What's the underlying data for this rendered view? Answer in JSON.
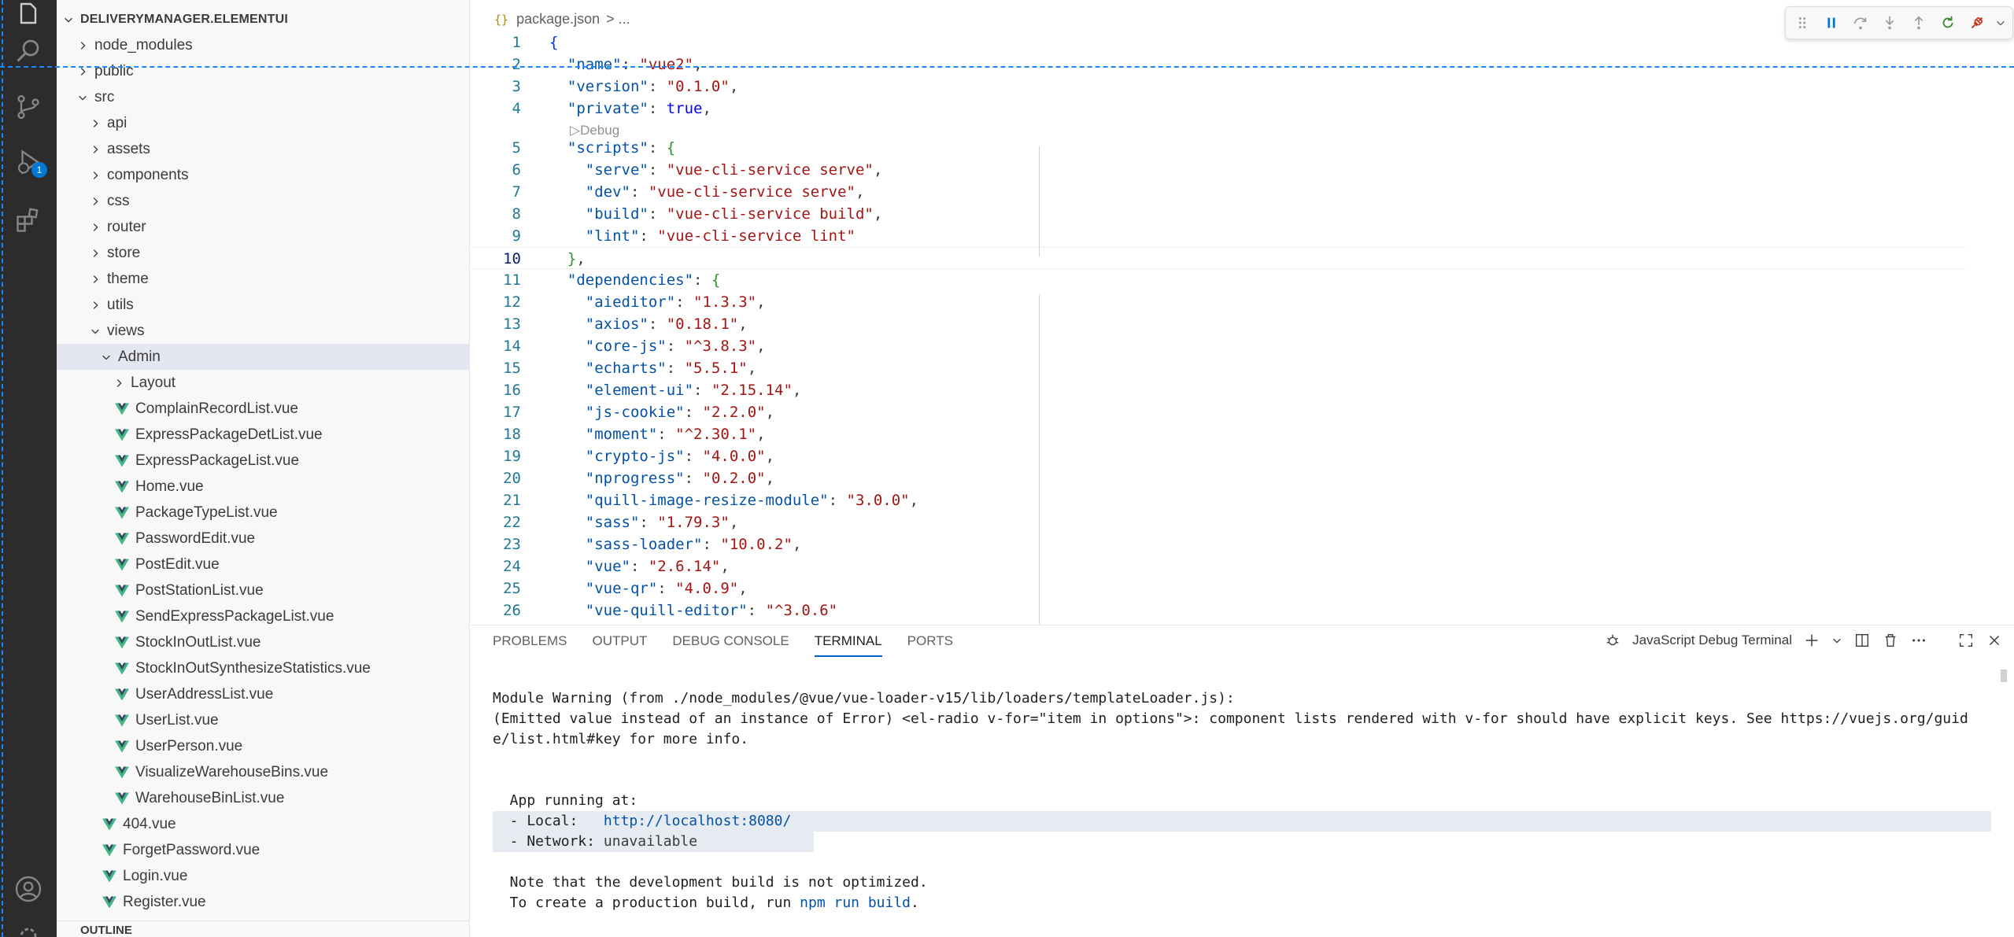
{
  "explorer": {
    "root_title": "DELIVERYMANAGER.ELEMENTUI",
    "outline_title": "OUTLINE",
    "tree": [
      {
        "label": "node_modules",
        "kind": "folder",
        "expanded": false,
        "depth": 1
      },
      {
        "label": "public",
        "kind": "folder",
        "expanded": false,
        "depth": 1
      },
      {
        "label": "src",
        "kind": "folder",
        "expanded": true,
        "depth": 1
      },
      {
        "label": "api",
        "kind": "folder",
        "expanded": false,
        "depth": 2
      },
      {
        "label": "assets",
        "kind": "folder",
        "expanded": false,
        "depth": 2
      },
      {
        "label": "components",
        "kind": "folder",
        "expanded": false,
        "depth": 2
      },
      {
        "label": "css",
        "kind": "folder",
        "expanded": false,
        "depth": 2
      },
      {
        "label": "router",
        "kind": "folder",
        "expanded": false,
        "depth": 2
      },
      {
        "label": "store",
        "kind": "folder",
        "expanded": false,
        "depth": 2
      },
      {
        "label": "theme",
        "kind": "folder",
        "expanded": false,
        "depth": 2
      },
      {
        "label": "utils",
        "kind": "folder",
        "expanded": false,
        "depth": 2
      },
      {
        "label": "views",
        "kind": "folder",
        "expanded": true,
        "depth": 2
      },
      {
        "label": "Admin",
        "kind": "folder",
        "expanded": true,
        "depth": 3,
        "selected": true
      },
      {
        "label": "Layout",
        "kind": "folder",
        "expanded": false,
        "depth": 4
      },
      {
        "label": "ComplainRecordList.vue",
        "kind": "vue",
        "depth": 4
      },
      {
        "label": "ExpressPackageDetList.vue",
        "kind": "vue",
        "depth": 4
      },
      {
        "label": "ExpressPackageList.vue",
        "kind": "vue",
        "depth": 4
      },
      {
        "label": "Home.vue",
        "kind": "vue",
        "depth": 4
      },
      {
        "label": "PackageTypeList.vue",
        "kind": "vue",
        "depth": 4
      },
      {
        "label": "PasswordEdit.vue",
        "kind": "vue",
        "depth": 4
      },
      {
        "label": "PostEdit.vue",
        "kind": "vue",
        "depth": 4
      },
      {
        "label": "PostStationList.vue",
        "kind": "vue",
        "depth": 4
      },
      {
        "label": "SendExpressPackageList.vue",
        "kind": "vue",
        "depth": 4
      },
      {
        "label": "StockInOutList.vue",
        "kind": "vue",
        "depth": 4
      },
      {
        "label": "StockInOutSynthesizeStatistics.vue",
        "kind": "vue",
        "depth": 4
      },
      {
        "label": "UserAddressList.vue",
        "kind": "vue",
        "depth": 4
      },
      {
        "label": "UserList.vue",
        "kind": "vue",
        "depth": 4
      },
      {
        "label": "UserPerson.vue",
        "kind": "vue",
        "depth": 4
      },
      {
        "label": "VisualizeWarehouseBins.vue",
        "kind": "vue",
        "depth": 4
      },
      {
        "label": "WarehouseBinList.vue",
        "kind": "vue",
        "depth": 4
      },
      {
        "label": "404.vue",
        "kind": "vue",
        "depth": 3
      },
      {
        "label": "ForgetPassword.vue",
        "kind": "vue",
        "depth": 3
      },
      {
        "label": "Login.vue",
        "kind": "vue",
        "depth": 3
      },
      {
        "label": "Register.vue",
        "kind": "vue",
        "depth": 3
      }
    ]
  },
  "activity_bar": {
    "icons": [
      "explorer-icon",
      "search-icon",
      "source-control-icon",
      "run-debug-icon",
      "extensions-icon",
      "account-icon"
    ],
    "debug_badge": "1"
  },
  "editor": {
    "breadcrumb_file": "package.json",
    "breadcrumb_rest": "> ...",
    "codelens": "▷Debug",
    "current_line": 10,
    "lines": [
      {
        "n": "1",
        "tokens": [
          [
            "b1",
            "{"
          ]
        ]
      },
      {
        "n": "2",
        "tokens": [
          [
            "",
            "  "
          ],
          [
            "k",
            "\"name\""
          ],
          [
            "",
            ": "
          ],
          [
            "s",
            "\"vue2\""
          ],
          [
            "",
            ","
          ]
        ]
      },
      {
        "n": "3",
        "tokens": [
          [
            "",
            "  "
          ],
          [
            "k",
            "\"version\""
          ],
          [
            "",
            ": "
          ],
          [
            "s",
            "\"0.1.0\""
          ],
          [
            "",
            ","
          ]
        ]
      },
      {
        "n": "4",
        "tokens": [
          [
            "",
            "  "
          ],
          [
            "k",
            "\"private\""
          ],
          [
            "",
            ": "
          ],
          [
            "kw",
            "true"
          ],
          [
            "",
            ","
          ]
        ]
      },
      {
        "n": "5",
        "tokens": [
          [
            "",
            "  "
          ],
          [
            "k",
            "\"scripts\""
          ],
          [
            "",
            ": "
          ],
          [
            "b2",
            "{"
          ]
        ]
      },
      {
        "n": "6",
        "tokens": [
          [
            "",
            "    "
          ],
          [
            "k",
            "\"serve\""
          ],
          [
            "",
            ": "
          ],
          [
            "s",
            "\"vue-cli-service serve\""
          ],
          [
            "",
            ","
          ]
        ]
      },
      {
        "n": "7",
        "tokens": [
          [
            "",
            "    "
          ],
          [
            "k",
            "\"dev\""
          ],
          [
            "",
            ": "
          ],
          [
            "s",
            "\"vue-cli-service serve\""
          ],
          [
            "",
            ","
          ]
        ]
      },
      {
        "n": "8",
        "tokens": [
          [
            "",
            "    "
          ],
          [
            "k",
            "\"build\""
          ],
          [
            "",
            ": "
          ],
          [
            "s",
            "\"vue-cli-service build\""
          ],
          [
            "",
            ","
          ]
        ]
      },
      {
        "n": "9",
        "tokens": [
          [
            "",
            "    "
          ],
          [
            "k",
            "\"lint\""
          ],
          [
            "",
            ": "
          ],
          [
            "s",
            "\"vue-cli-service lint\""
          ]
        ]
      },
      {
        "n": "10",
        "tokens": [
          [
            "",
            "  "
          ],
          [
            "b2",
            "}"
          ],
          [
            "",
            ","
          ]
        ]
      },
      {
        "n": "11",
        "tokens": [
          [
            "",
            "  "
          ],
          [
            "k",
            "\"dependencies\""
          ],
          [
            "",
            ": "
          ],
          [
            "b2",
            "{"
          ]
        ]
      },
      {
        "n": "12",
        "tokens": [
          [
            "",
            "    "
          ],
          [
            "k",
            "\"aieditor\""
          ],
          [
            "",
            ": "
          ],
          [
            "s",
            "\"1.3.3\""
          ],
          [
            "",
            ","
          ]
        ]
      },
      {
        "n": "13",
        "tokens": [
          [
            "",
            "    "
          ],
          [
            "k",
            "\"axios\""
          ],
          [
            "",
            ": "
          ],
          [
            "s",
            "\"0.18.1\""
          ],
          [
            "",
            ","
          ]
        ]
      },
      {
        "n": "14",
        "tokens": [
          [
            "",
            "    "
          ],
          [
            "k",
            "\"core-js\""
          ],
          [
            "",
            ": "
          ],
          [
            "s",
            "\"^3.8.3\""
          ],
          [
            "",
            ","
          ]
        ]
      },
      {
        "n": "15",
        "tokens": [
          [
            "",
            "    "
          ],
          [
            "k",
            "\"echarts\""
          ],
          [
            "",
            ": "
          ],
          [
            "s",
            "\"5.5.1\""
          ],
          [
            "",
            ","
          ]
        ]
      },
      {
        "n": "16",
        "tokens": [
          [
            "",
            "    "
          ],
          [
            "k",
            "\"element-ui\""
          ],
          [
            "",
            ": "
          ],
          [
            "s",
            "\"2.15.14\""
          ],
          [
            "",
            ","
          ]
        ]
      },
      {
        "n": "17",
        "tokens": [
          [
            "",
            "    "
          ],
          [
            "k",
            "\"js-cookie\""
          ],
          [
            "",
            ": "
          ],
          [
            "s",
            "\"2.2.0\""
          ],
          [
            "",
            ","
          ]
        ]
      },
      {
        "n": "18",
        "tokens": [
          [
            "",
            "    "
          ],
          [
            "k",
            "\"moment\""
          ],
          [
            "",
            ": "
          ],
          [
            "s",
            "\"^2.30.1\""
          ],
          [
            "",
            ","
          ]
        ]
      },
      {
        "n": "19",
        "tokens": [
          [
            "",
            "    "
          ],
          [
            "k",
            "\"crypto-js\""
          ],
          [
            "",
            ": "
          ],
          [
            "s",
            "\"4.0.0\""
          ],
          [
            "",
            ","
          ]
        ]
      },
      {
        "n": "20",
        "tokens": [
          [
            "",
            "    "
          ],
          [
            "k",
            "\"nprogress\""
          ],
          [
            "",
            ": "
          ],
          [
            "s",
            "\"0.2.0\""
          ],
          [
            "",
            ","
          ]
        ]
      },
      {
        "n": "21",
        "tokens": [
          [
            "",
            "    "
          ],
          [
            "k",
            "\"quill-image-resize-module\""
          ],
          [
            "",
            ": "
          ],
          [
            "s",
            "\"3.0.0\""
          ],
          [
            "",
            ","
          ]
        ]
      },
      {
        "n": "22",
        "tokens": [
          [
            "",
            "    "
          ],
          [
            "k",
            "\"sass\""
          ],
          [
            "",
            ": "
          ],
          [
            "s",
            "\"1.79.3\""
          ],
          [
            "",
            ","
          ]
        ]
      },
      {
        "n": "23",
        "tokens": [
          [
            "",
            "    "
          ],
          [
            "k",
            "\"sass-loader\""
          ],
          [
            "",
            ": "
          ],
          [
            "s",
            "\"10.0.2\""
          ],
          [
            "",
            ","
          ]
        ]
      },
      {
        "n": "24",
        "tokens": [
          [
            "",
            "    "
          ],
          [
            "k",
            "\"vue\""
          ],
          [
            "",
            ": "
          ],
          [
            "s",
            "\"2.6.14\""
          ],
          [
            "",
            ","
          ]
        ]
      },
      {
        "n": "25",
        "tokens": [
          [
            "",
            "    "
          ],
          [
            "k",
            "\"vue-qr\""
          ],
          [
            "",
            ": "
          ],
          [
            "s",
            "\"4.0.9\""
          ],
          [
            "",
            ","
          ]
        ]
      },
      {
        "n": "26",
        "tokens": [
          [
            "",
            "    "
          ],
          [
            "k",
            "\"vue-quill-editor\""
          ],
          [
            "",
            ": "
          ],
          [
            "s",
            "\"^3.0.6\""
          ]
        ]
      }
    ]
  },
  "debug_toolbar": {
    "buttons": [
      "drag-handle-icon",
      "pause-icon",
      "step-over-icon",
      "step-into-icon",
      "step-out-icon",
      "restart-icon",
      "disconnect-icon"
    ]
  },
  "panel": {
    "tabs": [
      "PROBLEMS",
      "OUTPUT",
      "DEBUG CONSOLE",
      "TERMINAL",
      "PORTS"
    ],
    "active_tab": "TERMINAL",
    "terminal_name": "JavaScript Debug Terminal",
    "terminal_lines": {
      "warn1": "Module Warning (from ./node_modules/@vue/vue-loader-v15/lib/loaders/templateLoader.js):",
      "warn2": "(Emitted value instead of an instance of Error) <el-radio v-for=\"item in options\">: component lists rendered with v-for should have explicit keys. See https://vuejs.org/guid",
      "warn3": "e/list.html#key for more info.",
      "app_running": "  App running at:",
      "local_label": "  - Local:   ",
      "local_url": "http://localhost:8080/",
      "network_label": "  - Network: ",
      "network_value": "unavailable",
      "note1": "  Note that the development build is not optimized.",
      "note2_prefix": "  To create a production build, run ",
      "note2_cmd": "npm run build",
      "note2_suffix": "."
    }
  },
  "colors": {
    "activity_bar": "#2c2c2c",
    "sidebar_bg": "#f8f8f8",
    "selected_row": "#e4e6f1",
    "vue_green": "#41b883",
    "json_key": "#0451a5",
    "json_string": "#a31515",
    "accent": "#005fb8"
  }
}
